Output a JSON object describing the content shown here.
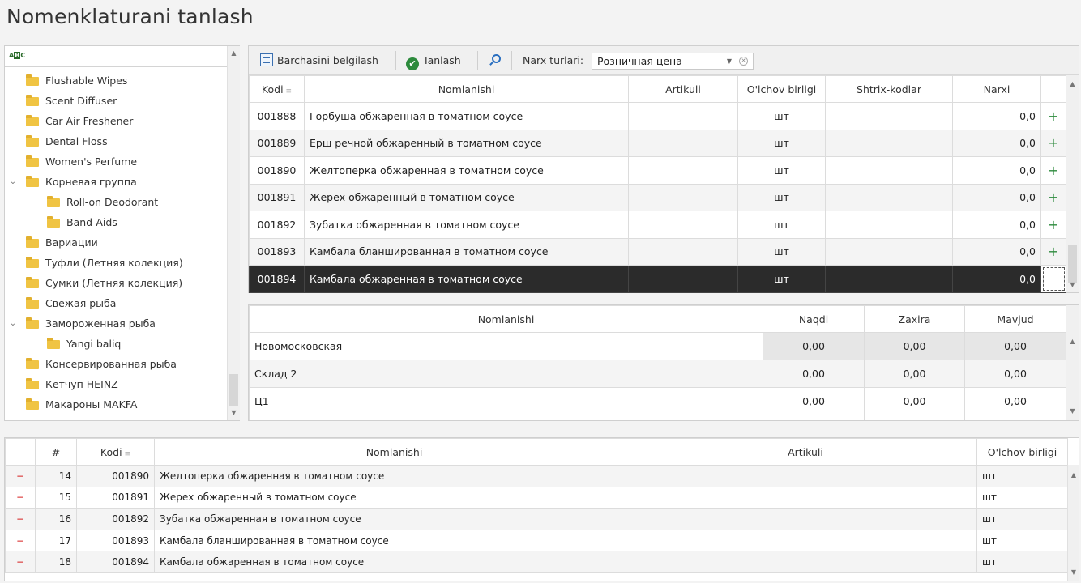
{
  "title": "Nomenklaturani tanlash",
  "tree": {
    "search_value": "",
    "items": [
      {
        "label": "Flushable Wipes",
        "level": 0,
        "expanded": null
      },
      {
        "label": "Scent Diffuser",
        "level": 0,
        "expanded": null
      },
      {
        "label": "Car Air Freshener",
        "level": 0,
        "expanded": null
      },
      {
        "label": "Dental Floss",
        "level": 0,
        "expanded": null
      },
      {
        "label": "Women's Perfume",
        "level": 0,
        "expanded": null
      },
      {
        "label": "Корневая группа",
        "level": 0,
        "expanded": true
      },
      {
        "label": "Roll-on Deodorant",
        "level": 1,
        "expanded": null
      },
      {
        "label": "Band-Aids",
        "level": 1,
        "expanded": null
      },
      {
        "label": "Вариации",
        "level": 0,
        "expanded": null
      },
      {
        "label": "Туфли (Летняя колекция)",
        "level": 0,
        "expanded": null
      },
      {
        "label": "Сумки (Летняя колекция)",
        "level": 0,
        "expanded": null
      },
      {
        "label": "Свежая рыба",
        "level": 0,
        "expanded": null
      },
      {
        "label": "Замороженная рыба",
        "level": 0,
        "expanded": true
      },
      {
        "label": "Yangi baliq",
        "level": 1,
        "expanded": null
      },
      {
        "label": "Консервированная рыба",
        "level": 0,
        "expanded": null
      },
      {
        "label": "Кетчуп HEINZ",
        "level": 0,
        "expanded": null
      },
      {
        "label": "Макароны MAKFA",
        "level": 0,
        "expanded": null
      }
    ]
  },
  "toolbar": {
    "select_all_label": "Barchasini belgilash",
    "select_label": "Tanlash",
    "price_types_label": "Narx turlari:",
    "price_type_value": "Розничная цена"
  },
  "items_grid": {
    "columns": [
      "Kodi",
      "Nomlanishi",
      "Artikuli",
      "O'lchov birligi",
      "Shtrix-kodlar",
      "Narxi"
    ],
    "rows": [
      {
        "code": "001888",
        "name": "Горбуша обжаренная в томатном соусе",
        "article": "",
        "unit": "шт",
        "barcodes": "",
        "price": "0,0"
      },
      {
        "code": "001889",
        "name": "Ерш речной обжаренный в томатном соусе",
        "article": "",
        "unit": "шт",
        "barcodes": "",
        "price": "0,0"
      },
      {
        "code": "001890",
        "name": "Желтоперка обжаренная в томатном соусе",
        "article": "",
        "unit": "шт",
        "barcodes": "",
        "price": "0,0"
      },
      {
        "code": "001891",
        "name": "Жерех обжаренный в томатном соусе",
        "article": "",
        "unit": "шт",
        "barcodes": "",
        "price": "0,0"
      },
      {
        "code": "001892",
        "name": "Зубатка обжаренная в томатном соусе",
        "article": "",
        "unit": "шт",
        "barcodes": "",
        "price": "0,0"
      },
      {
        "code": "001893",
        "name": "Камбала бланшированная в томатном соусе",
        "article": "",
        "unit": "шт",
        "barcodes": "",
        "price": "0,0"
      },
      {
        "code": "001894",
        "name": "Камбала обжаренная в томатном соусе",
        "article": "",
        "unit": "шт",
        "barcodes": "",
        "price": "0,0"
      }
    ],
    "selected_index": 6
  },
  "stock_grid": {
    "columns": [
      "Nomlanishi",
      "Naqdi",
      "Zaxira",
      "Mavjud"
    ],
    "rows": [
      {
        "name": "Новомосковская",
        "cash": "0,00",
        "reserve": "0,00",
        "available": "0,00"
      },
      {
        "name": "Склад 2",
        "cash": "0,00",
        "reserve": "0,00",
        "available": "0,00"
      },
      {
        "name": "Ц1",
        "cash": "0,00",
        "reserve": "0,00",
        "available": "0,00"
      }
    ]
  },
  "selected_grid": {
    "columns": [
      "#",
      "Kodi",
      "Nomlanishi",
      "Artikuli",
      "O'lchov birligi"
    ],
    "rows": [
      {
        "n": "14",
        "code": "001890",
        "name": "Желтоперка обжаренная в томатном соусе",
        "article": "",
        "unit": "шт"
      },
      {
        "n": "15",
        "code": "001891",
        "name": "Жерех обжаренный в томатном соусе",
        "article": "",
        "unit": "шт"
      },
      {
        "n": "16",
        "code": "001892",
        "name": "Зубатка обжаренная в томатном соусе",
        "article": "",
        "unit": "шт"
      },
      {
        "n": "17",
        "code": "001893",
        "name": "Камбала бланшированная в томатном соусе",
        "article": "",
        "unit": "шт"
      },
      {
        "n": "18",
        "code": "001894",
        "name": "Камбала обжаренная в томатном соусе",
        "article": "",
        "unit": "шт"
      }
    ]
  },
  "colors": {
    "accent_green": "#2c8a3c",
    "remove_red": "#d62020",
    "selected_row": "#2b2b2b",
    "folder": "#f0c443"
  }
}
